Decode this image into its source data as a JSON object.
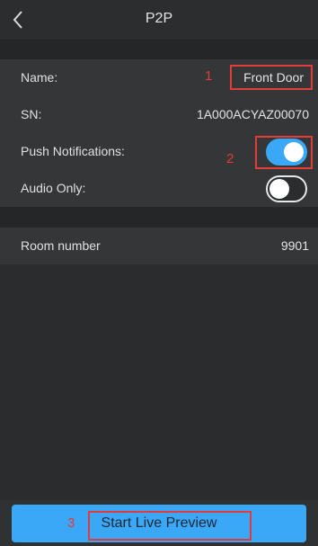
{
  "header": {
    "title": "P2P",
    "back_icon": "chevron-left-icon"
  },
  "fields": {
    "name": {
      "label": "Name:",
      "value": "Front Door"
    },
    "sn": {
      "label": "SN:",
      "value": "1A000ACYAZ00070"
    },
    "push": {
      "label": "Push Notifications:",
      "on": true
    },
    "audio": {
      "label": "Audio Only:",
      "on": false
    },
    "room": {
      "label": "Room number",
      "value": "9901"
    }
  },
  "annotations": {
    "one": "1",
    "two": "2",
    "three": "3"
  },
  "actions": {
    "start_label": "Start Live Preview"
  },
  "colors": {
    "accent": "#3ba7f7",
    "annotation_red": "#e33a3a",
    "background": "#2a2c2e",
    "row_background": "#343638"
  }
}
